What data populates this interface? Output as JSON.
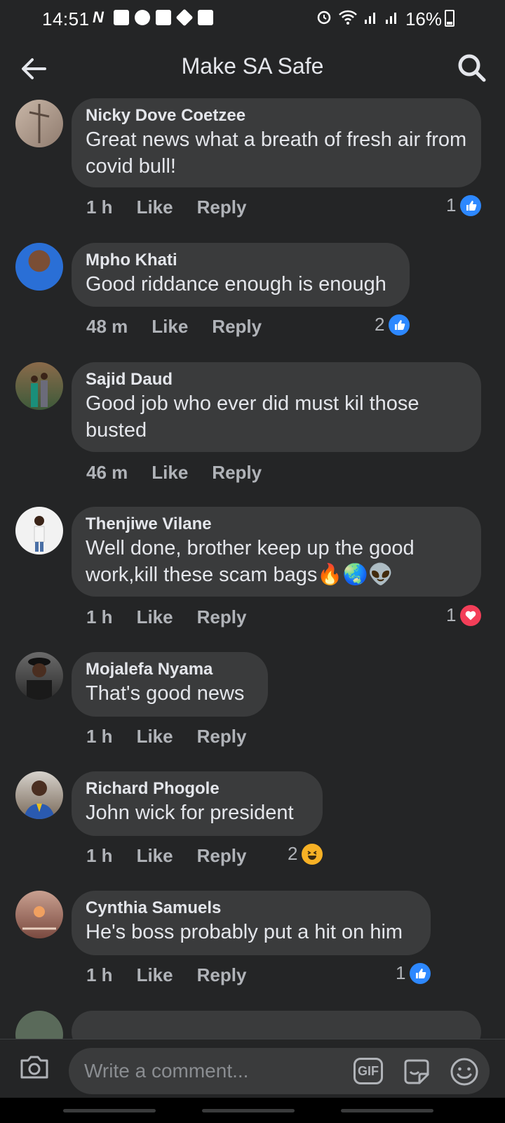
{
  "status_bar": {
    "time": "14:51",
    "battery": "16%"
  },
  "header": {
    "title": "Make SA Safe"
  },
  "comments": [
    {
      "author": "Nicky Dove Coetzee",
      "text": "Great news what a breath of fresh air from covid bull!",
      "time": "1 h",
      "like_label": "Like",
      "reply_label": "Reply",
      "reaction_count": "1",
      "reaction_type": "like"
    },
    {
      "author": "Mpho Khati",
      "text": "Good riddance enough is enough",
      "time": "48 m",
      "like_label": "Like",
      "reply_label": "Reply",
      "reaction_count": "2",
      "reaction_type": "like"
    },
    {
      "author": "Sajid Daud",
      "text": "Good job who ever did must kil those busted",
      "time": "46 m",
      "like_label": "Like",
      "reply_label": "Reply",
      "reaction_count": "",
      "reaction_type": ""
    },
    {
      "author": "Thenjiwe Vilane",
      "text": "Well done, brother keep up the good work,kill these scam bags🔥🌏👽",
      "time": "1 h",
      "like_label": "Like",
      "reply_label": "Reply",
      "reaction_count": "1",
      "reaction_type": "love"
    },
    {
      "author": "Mojalefa Nyama",
      "text": "That's good news",
      "time": "1 h",
      "like_label": "Like",
      "reply_label": "Reply",
      "reaction_count": "",
      "reaction_type": ""
    },
    {
      "author": "Richard Phogole",
      "text": "John wick for president",
      "time": "1 h",
      "like_label": "Like",
      "reply_label": "Reply",
      "reaction_count": "2",
      "reaction_type": "haha"
    },
    {
      "author": "Cynthia Samuels",
      "text": "He's boss probably put a hit on him",
      "time": "1 h",
      "like_label": "Like",
      "reply_label": "Reply",
      "reaction_count": "1",
      "reaction_type": "like"
    }
  ],
  "composer": {
    "placeholder": "Write a comment...",
    "gif_label": "GIF"
  },
  "colors": {
    "background": "#242526",
    "bubble": "#3a3b3c",
    "text_primary": "#e4e6eb",
    "text_secondary": "#b0b3b8",
    "like_blue": "#2d88ff",
    "love_red": "#f33e58",
    "haha_yellow": "#f7b125"
  },
  "icons": [
    "back-arrow-icon",
    "search-icon",
    "camera-icon",
    "gif-icon",
    "sticker-icon",
    "emoji-icon",
    "like-reaction-icon",
    "love-reaction-icon",
    "haha-reaction-icon"
  ]
}
